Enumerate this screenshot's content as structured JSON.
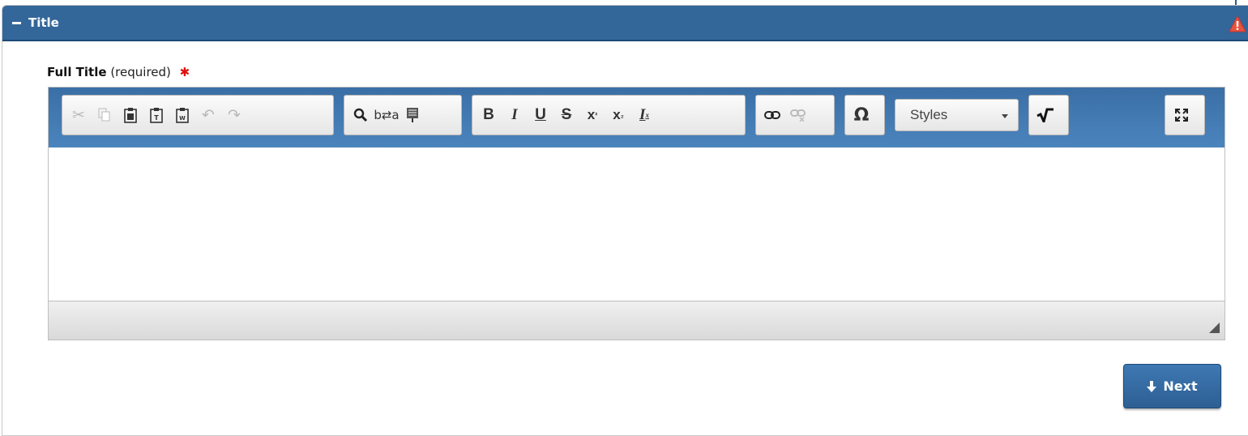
{
  "panel": {
    "title": "Title",
    "collapse_icon": "minus-icon",
    "warning_icon": "warning-triangle-icon",
    "header_color": "#336699"
  },
  "field": {
    "label": "Full Title",
    "required_text": "(required)",
    "required_marker": "✱"
  },
  "editor": {
    "toolbar_groups": [
      {
        "name": "clipboard",
        "buttons": [
          {
            "name": "cut-icon",
            "glyph": "✂",
            "enabled": false
          },
          {
            "name": "copy-icon",
            "glyph": "⧉",
            "enabled": false
          },
          {
            "name": "paste-icon",
            "glyph": "📋",
            "enabled": true
          },
          {
            "name": "paste-text-icon",
            "glyph": "📋",
            "enabled": true
          },
          {
            "name": "paste-word-icon",
            "glyph": "📋",
            "enabled": true
          },
          {
            "name": "undo-icon",
            "glyph": "↶",
            "enabled": false
          },
          {
            "name": "redo-icon",
            "glyph": "↷",
            "enabled": false
          }
        ]
      },
      {
        "name": "editing",
        "buttons": [
          {
            "name": "find-icon",
            "glyph": "🔍",
            "enabled": true
          },
          {
            "name": "replace-icon",
            "glyph": "⇄",
            "enabled": true
          },
          {
            "name": "select-all-icon",
            "glyph": "▤",
            "enabled": true
          }
        ]
      },
      {
        "name": "basicstyles",
        "buttons": [
          {
            "name": "bold-icon",
            "glyph": "B",
            "enabled": true
          },
          {
            "name": "italic-icon",
            "glyph": "I",
            "enabled": true
          },
          {
            "name": "underline-icon",
            "glyph": "U",
            "enabled": true
          },
          {
            "name": "strikethrough-icon",
            "glyph": "S",
            "enabled": true
          },
          {
            "name": "superscript-icon",
            "glyph": "x²",
            "enabled": true
          },
          {
            "name": "subscript-icon",
            "glyph": "x₂",
            "enabled": true
          },
          {
            "name": "remove-format-icon",
            "glyph": "Iₓ",
            "enabled": true
          }
        ]
      },
      {
        "name": "links",
        "buttons": [
          {
            "name": "link-icon",
            "glyph": "🔗",
            "enabled": true
          },
          {
            "name": "unlink-icon",
            "glyph": "🔗",
            "enabled": false
          }
        ]
      },
      {
        "name": "insert",
        "buttons": [
          {
            "name": "special-char-icon",
            "glyph": "Ω",
            "enabled": true
          }
        ]
      }
    ],
    "styles_select": {
      "value": "Styles"
    },
    "math_icon": "square-root-icon",
    "maximize_icon": "maximize-icon",
    "content": ""
  },
  "next_button": {
    "label": "Next",
    "icon": "arrow-down-icon"
  }
}
